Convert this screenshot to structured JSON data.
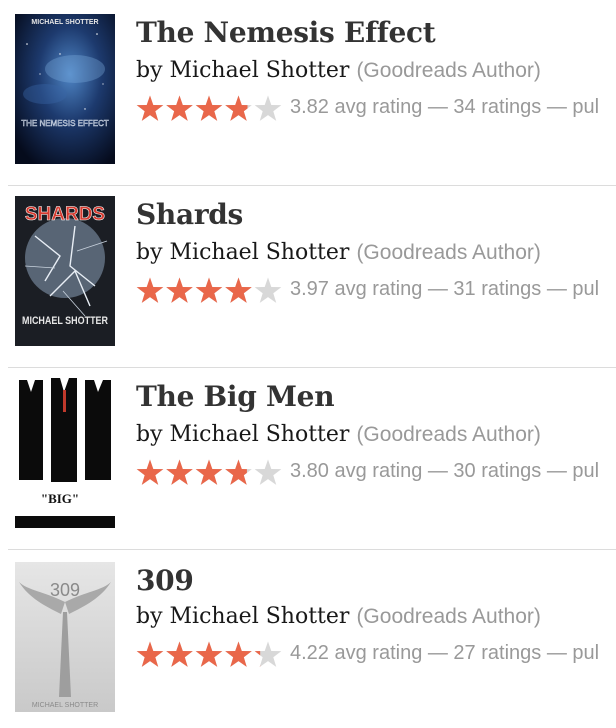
{
  "colors": {
    "star_filled": "#e9674a",
    "star_empty": "#d8d8d8",
    "muted": "#999999",
    "title": "#333333"
  },
  "books": [
    {
      "title": "The Nemesis Effect",
      "by_label": "by",
      "author": "Michael Shotter",
      "author_badge": "(Goodreads Author)",
      "rating": 3.82,
      "minirating": "3.82 avg rating — 34 ratings — pul",
      "cover": {
        "top_text": "MICHAEL SHOTTER",
        "title_text": "THE NEMESIS EFFECT"
      }
    },
    {
      "title": "Shards",
      "by_label": "by",
      "author": "Michael Shotter",
      "author_badge": "(Goodreads Author)",
      "rating": 3.97,
      "minirating": "3.97 avg rating — 31 ratings — pul",
      "cover": {
        "top_text": "SHARDS",
        "title_text": "MICHAEL SHOTTER"
      }
    },
    {
      "title": "The Big Men",
      "by_label": "by",
      "author": "Michael Shotter",
      "author_badge": "(Goodreads Author)",
      "rating": 3.8,
      "minirating": "3.80 avg rating — 30 ratings — pul",
      "cover": {
        "top_text": "",
        "title_text": "\"BIG\""
      }
    },
    {
      "title": "309",
      "by_label": "by",
      "author": "Michael Shotter",
      "author_badge": "(Goodreads Author)",
      "rating": 4.22,
      "minirating": "4.22 avg rating — 27 ratings — pul",
      "cover": {
        "top_text": "309",
        "title_text": "MICHAEL SHOTTER"
      }
    }
  ]
}
